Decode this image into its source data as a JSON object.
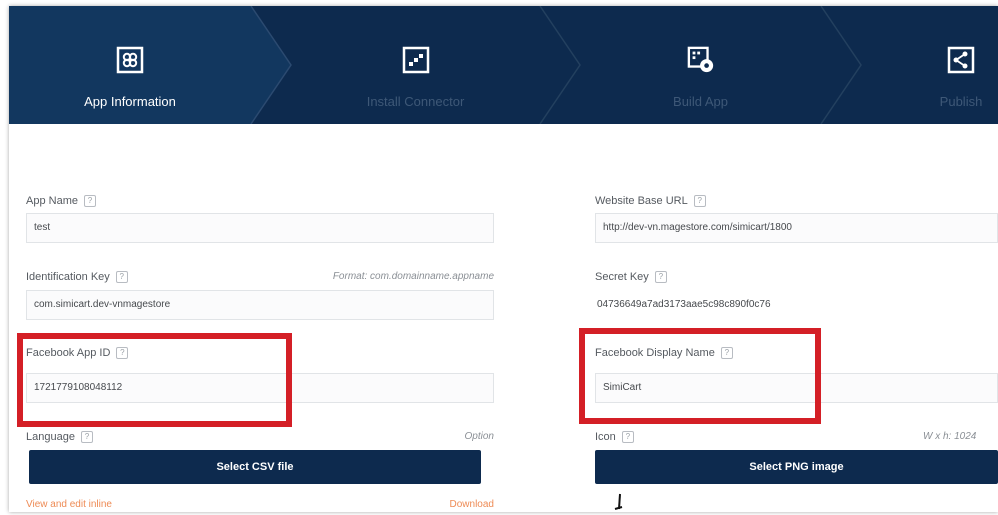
{
  "colors": {
    "stepper_bg": "#0d2a4e",
    "button_bg": "#0d2a4e",
    "highlight": "#d41f26",
    "link": "#ee8b55"
  },
  "steps": [
    {
      "label": "App Information",
      "icon": "app-info-icon",
      "active": true
    },
    {
      "label": "Install Connector",
      "icon": "install-connector-icon",
      "active": false
    },
    {
      "label": "Build App",
      "icon": "build-app-icon",
      "active": false
    },
    {
      "label": "Publish",
      "icon": "share-icon",
      "active": false
    }
  ],
  "help_glyph": "?",
  "form": {
    "app_name": {
      "label": "App Name",
      "value": "test"
    },
    "identification_key": {
      "label": "Identification Key",
      "hint": "Format: com.domainname.appname",
      "value": "com.simicart.dev-vnmagestore"
    },
    "facebook_app_id": {
      "label": "Facebook App ID",
      "value": "1721779108048112"
    },
    "language": {
      "label": "Language",
      "hint": "Option",
      "button": "Select CSV file",
      "link_left": "View and edit inline",
      "link_right": "Download"
    },
    "website_base_url": {
      "label": "Website Base URL",
      "value": "http://dev-vn.magestore.com/simicart/1800"
    },
    "secret_key": {
      "label": "Secret Key",
      "value": "04736649a7ad3173aae5c98c890f0c76"
    },
    "facebook_display_name": {
      "label": "Facebook Display Name",
      "value": "SimiCart"
    },
    "icon": {
      "label": "Icon",
      "hint": "W x h: 1024",
      "button": "Select PNG image"
    }
  }
}
